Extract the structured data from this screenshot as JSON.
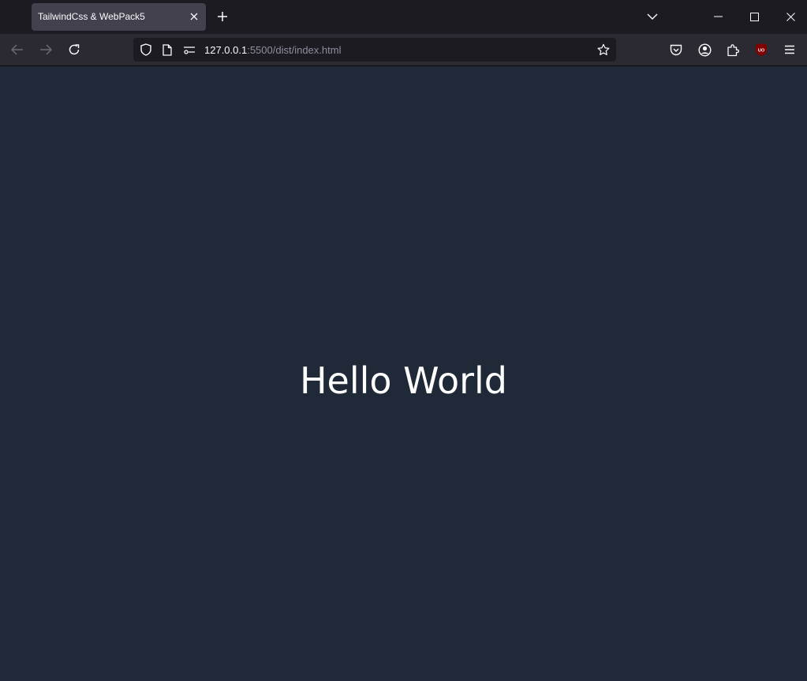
{
  "browser": {
    "tab": {
      "title": "TailwindCss & WebPack5"
    },
    "url": {
      "host": "127.0.0.1",
      "rest": ":5500/dist/index.html"
    },
    "icons": {
      "tab_close": "close-icon",
      "new_tab": "plus-icon",
      "tab_list": "chevron-down-icon",
      "minimize": "minimize-icon",
      "maximize": "maximize-icon",
      "close_window": "close-icon",
      "back": "arrow-left-icon",
      "forward": "arrow-right-icon",
      "reload": "reload-icon",
      "tracking": "shield-icon",
      "page": "page-icon",
      "permissions": "permissions-icon",
      "bookmark": "star-icon",
      "pocket": "pocket-icon",
      "account": "account-icon",
      "extensions": "puzzle-icon",
      "ublock": "ublock-origin-icon",
      "menu": "hamburger-menu-icon"
    },
    "ublock_badge": "UO"
  },
  "page": {
    "heading": "Hello World",
    "background": "#1f2937",
    "text_color": "#ffffff"
  }
}
